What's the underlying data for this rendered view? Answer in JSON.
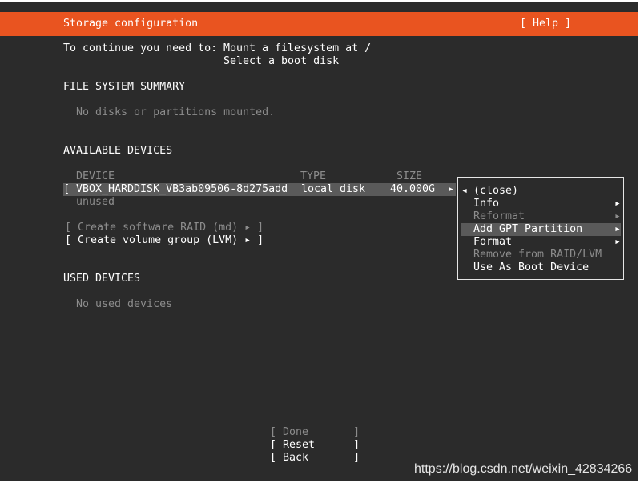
{
  "header": {
    "title": "Storage configuration",
    "help_label": "[ Help ]"
  },
  "prompt": {
    "lead": "To continue you need to:",
    "line1": "Mount a filesystem at /",
    "line2": "Select a boot disk"
  },
  "fs_summary": {
    "heading": "FILE SYSTEM SUMMARY",
    "empty_text": "No disks or partitions mounted."
  },
  "available": {
    "heading": "AVAILABLE DEVICES",
    "columns": {
      "device": "DEVICE",
      "type": "TYPE",
      "size": "SIZE"
    },
    "device_row": {
      "bracket": "[",
      "name": "VBOX_HARDDISK_VB3ab09506-8d275add",
      "type": "local disk",
      "size": "40.000G",
      "arrow": "▸",
      "sub": "unused"
    },
    "raid_action": "[ Create software RAID (md) ▸ ]",
    "lvm_action": "[ Create volume group (LVM) ▸ ]"
  },
  "context_menu": {
    "close_arrow": "◂",
    "close_label": "(close)",
    "items": [
      {
        "label": "Info",
        "arrow": "▸"
      },
      {
        "label": "Reformat",
        "arrow": "▸"
      },
      {
        "label": "Add GPT Partition",
        "arrow": "▸"
      },
      {
        "label": "Format",
        "arrow": "▸"
      },
      {
        "label": "Remove from RAID/LVM",
        "arrow": ""
      },
      {
        "label": "Use As Boot Device",
        "arrow": ""
      }
    ]
  },
  "used": {
    "heading": "USED DEVICES",
    "empty_text": "No used devices"
  },
  "footer": {
    "done": "[ Done       ]",
    "reset": "[ Reset      ]",
    "back": "[ Back       ]"
  },
  "watermark": "https://blog.csdn.net/weixin_42834266"
}
